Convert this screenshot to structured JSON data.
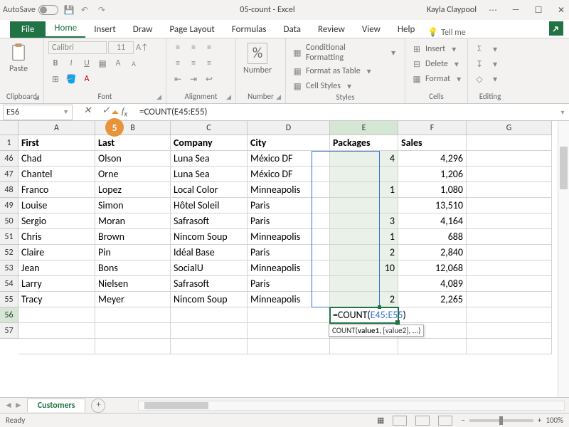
{
  "titlebar": {
    "autosave": "AutoSave",
    "doc": "05-count - Excel",
    "user": "Kayla Claypool"
  },
  "tabs": {
    "file": "File",
    "home": "Home",
    "insert": "Insert",
    "draw": "Draw",
    "layout": "Page Layout",
    "formulas": "Formulas",
    "data": "Data",
    "review": "Review",
    "view": "View",
    "help": "Help",
    "tellme": "Tell me"
  },
  "ribbon": {
    "paste": "Paste",
    "fontname": "Calibri",
    "fontsize": "11",
    "number": "Number",
    "condfmt": "Conditional Formatting",
    "tablefmt": "Format as Table",
    "cellstyles": "Cell Styles",
    "insert": "Insert",
    "delete": "Delete",
    "format": "Format",
    "g_clipboard": "Clipboard",
    "g_font": "Font",
    "g_align": "Alignment",
    "g_number": "Number",
    "g_styles": "Styles",
    "g_cells": "Cells",
    "g_editing": "Editing"
  },
  "namebox": "E56",
  "formula": "=COUNT(E45:E55)",
  "callout": "5",
  "cols": [
    "A",
    "B",
    "C",
    "D",
    "E",
    "F",
    "G"
  ],
  "headers": [
    "First",
    "Last",
    "Company",
    "City",
    "Packages",
    "Sales"
  ],
  "rows": [
    {
      "n": 46,
      "d": [
        "Chad",
        "Olson",
        "Luna Sea",
        "México DF",
        "4",
        "4,296"
      ]
    },
    {
      "n": 47,
      "d": [
        "Chantel",
        "Orne",
        "Luna Sea",
        "México DF",
        "",
        "1,206"
      ]
    },
    {
      "n": 48,
      "d": [
        "Franco",
        "Lopez",
        "Local Color",
        "Minneapolis",
        "1",
        "1,080"
      ]
    },
    {
      "n": 49,
      "d": [
        "Louise",
        "Simon",
        "Hôtel Soleil",
        "Paris",
        "",
        "13,510"
      ]
    },
    {
      "n": 50,
      "d": [
        "Sergio",
        "Moran",
        "Safrasoft",
        "Paris",
        "3",
        "4,164"
      ]
    },
    {
      "n": 51,
      "d": [
        "Chris",
        "Brown",
        "Nincom Soup",
        "Minneapolis",
        "1",
        "688"
      ]
    },
    {
      "n": 52,
      "d": [
        "Claire",
        "Pin",
        "Idéal Base",
        "Paris",
        "2",
        "2,840"
      ]
    },
    {
      "n": 53,
      "d": [
        "Jean",
        "Bons",
        "SocialU",
        "Minneapolis",
        "10",
        "12,068"
      ]
    },
    {
      "n": 54,
      "d": [
        "Larry",
        "Nielsen",
        "Safrasoft",
        "Paris",
        "",
        "4,089"
      ]
    },
    {
      "n": 55,
      "d": [
        "Tracy",
        "Meyer",
        "Nincom Soup",
        "Minneapolis",
        "2",
        "2,265"
      ]
    }
  ],
  "activeCell": {
    "formula_prefix": "=COUNT(",
    "formula_ref": "E45:E55",
    "formula_suffix": ")"
  },
  "tooltip": {
    "fn": "COUNT(",
    "arg1": "value1",
    "rest": ", [value2], ...)"
  },
  "sheet": "Customers",
  "status": {
    "ready": "Ready",
    "zoom": "100%"
  },
  "chart_data": {
    "type": "table",
    "title": "Customers",
    "columns": [
      "First",
      "Last",
      "Company",
      "City",
      "Packages",
      "Sales"
    ],
    "data": [
      [
        "Chad",
        "Olson",
        "Luna Sea",
        "México DF",
        4,
        4296
      ],
      [
        "Chantel",
        "Orne",
        "Luna Sea",
        "México DF",
        null,
        1206
      ],
      [
        "Franco",
        "Lopez",
        "Local Color",
        "Minneapolis",
        1,
        1080
      ],
      [
        "Louise",
        "Simon",
        "Hôtel Soleil",
        "Paris",
        null,
        13510
      ],
      [
        "Sergio",
        "Moran",
        "Safrasoft",
        "Paris",
        3,
        4164
      ],
      [
        "Chris",
        "Brown",
        "Nincom Soup",
        "Minneapolis",
        1,
        688
      ],
      [
        "Claire",
        "Pin",
        "Idéal Base",
        "Paris",
        2,
        2840
      ],
      [
        "Jean",
        "Bons",
        "SocialU",
        "Minneapolis",
        10,
        12068
      ],
      [
        "Larry",
        "Nielsen",
        "Safrasoft",
        "Paris",
        null,
        4089
      ],
      [
        "Tracy",
        "Meyer",
        "Nincom Soup",
        "Minneapolis",
        2,
        2265
      ]
    ],
    "formula_cell": {
      "address": "E56",
      "formula": "=COUNT(E45:E55)"
    }
  }
}
